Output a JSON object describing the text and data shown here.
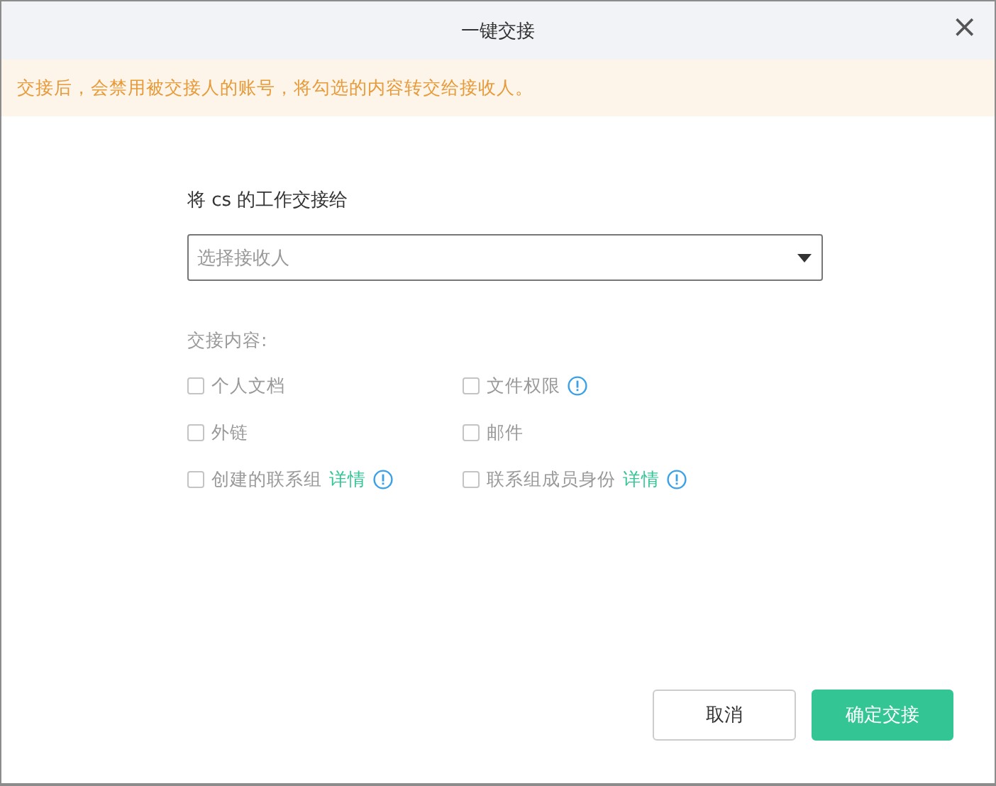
{
  "dialog": {
    "title": "一键交接",
    "close": "×"
  },
  "notice": "交接后，会禁用被交接人的账号，将勾选的内容转交给接收人。",
  "recipient": {
    "label": "将 cs 的工作交接给",
    "placeholder": "选择接收人"
  },
  "content": {
    "label": "交接内容:",
    "items": [
      {
        "label": "个人文档",
        "checked": false,
        "disabled": true,
        "info": false
      },
      {
        "label": "文件权限",
        "checked": false,
        "disabled": true,
        "info": true
      },
      {
        "label": "外链",
        "checked": false,
        "disabled": true,
        "info": false
      },
      {
        "label": "邮件",
        "checked": false,
        "disabled": true,
        "info": false
      },
      {
        "label": "创建的联系组",
        "checked": false,
        "disabled": true,
        "info": true,
        "link": "详情"
      },
      {
        "label": "联系组成员身份",
        "checked": false,
        "disabled": true,
        "info": true,
        "link": "详情"
      }
    ]
  },
  "buttons": [
    {
      "label": "取消",
      "kind": "secondary"
    },
    {
      "label": "确定交接",
      "kind": "primary"
    }
  ]
}
